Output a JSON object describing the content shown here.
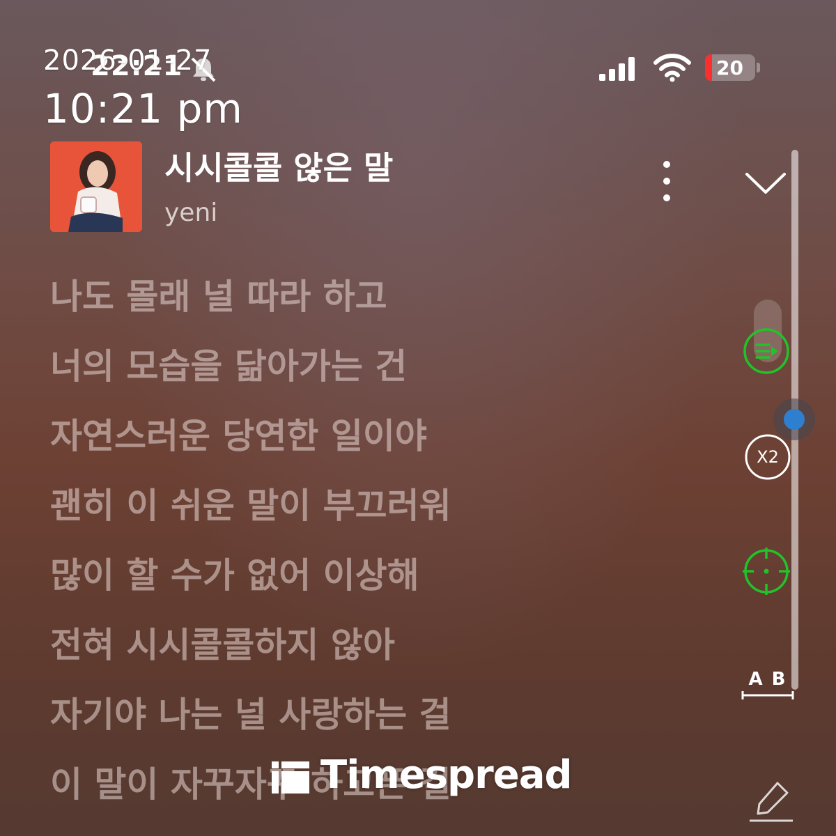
{
  "status_bar": {
    "clock": "22:21",
    "battery_level": "20",
    "battery_color": "#ff2e2e"
  },
  "timestamp_overlay": {
    "date": "2026-01-27",
    "time": "10:21 pm"
  },
  "track": {
    "title": "시시콜콜 않은 말",
    "artist": "yeni",
    "album_art_color": "#e8543a"
  },
  "lyrics": [
    "나도 몰래 널 따라 하고",
    "너의 모습을 닮아가는 건",
    "자연스러운 당연한 일이야",
    "괜히 이 쉬운 말이 부끄러워",
    "많이 할 수가 없어 이상해",
    "전혀 시시콜콜하지 않아",
    "자기야 나는 널 사랑하는 걸",
    "이 말이 자꾸자꾸 하고픈 걸"
  ],
  "side_controls": {
    "speed_label": "X2",
    "ab_label": "A B",
    "active_color": "#22c22a"
  },
  "watermark": {
    "text": "Timespread"
  },
  "icons": {
    "notification": "bell-off-icon",
    "signal": "cellular-signal-icon",
    "wifi": "wifi-icon",
    "more": "more-vertical-icon",
    "collapse": "chevron-down-icon",
    "queue": "playlist-play-icon",
    "scrubber": "scrubber-handle",
    "speed": "speed-icon",
    "locate": "crosshair-icon",
    "ab_repeat": "ab-repeat-icon",
    "edit": "pen-icon"
  }
}
